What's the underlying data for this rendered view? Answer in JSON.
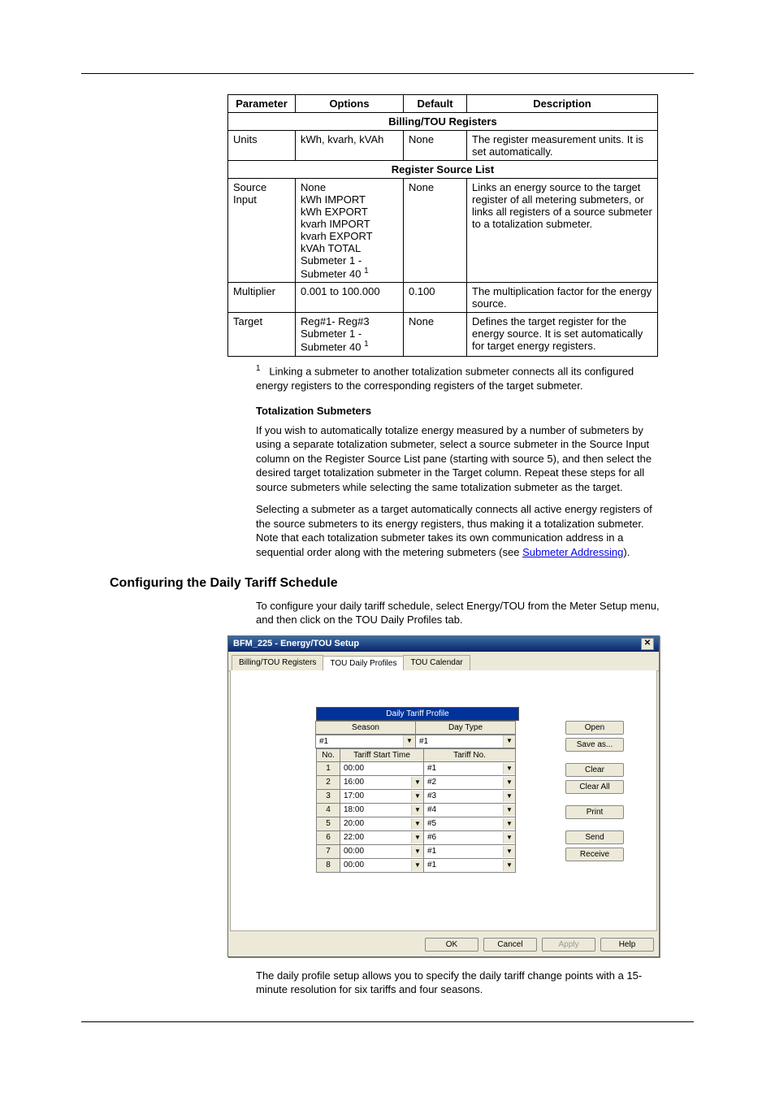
{
  "table": {
    "headers": [
      "Parameter",
      "Options",
      "Default",
      "Description"
    ],
    "section1": "Billing/TOU Registers",
    "row_units": {
      "param": "Units",
      "options": "kWh, kvarh, kVAh",
      "default": "None",
      "desc": "The register measurement units. It is set automatically."
    },
    "section2": "Register Source List",
    "row_source": {
      "param": "Source Input",
      "options_lines": [
        "None",
        "kWh IMPORT",
        "kWh EXPORT",
        "kvarh IMPORT",
        "kvarh EXPORT",
        "kVAh TOTAL",
        "Submeter 1 - Submeter 40"
      ],
      "default": "None",
      "desc": "Links an energy source to the target register of all metering submeters, or links all registers of a source submeter to a totalization submeter."
    },
    "row_mult": {
      "param": "Multiplier",
      "options": "0.001 to 100.000",
      "default": "0.100",
      "desc": "The multiplication factor for the energy source."
    },
    "row_target": {
      "param": "Target",
      "options_lines": [
        "Reg#1- Reg#3",
        "Submeter 1 - Submeter 40"
      ],
      "default": "None",
      "desc": "Defines the target register for the energy source. It is set automatically for target energy registers."
    }
  },
  "footnote_marker": "1",
  "footnote_text": "Linking a submeter to another totalization submeter connects all its configured energy registers to the corresponding registers of the target submeter.",
  "totalization_heading": "Totalization Submeters",
  "totalization_p1": "If you wish to automatically totalize energy measured by a number of submeters by using a separate totalization submeter, select a source submeter in the Source Input column on the Register Source List pane (starting with source 5), and then select the desired target totalization submeter in the Target column. Repeat these steps for all source submeters while selecting the same totalization submeter as the target.",
  "totalization_p2_a": "Selecting a submeter as a target automatically connects all active energy registers of the source submeters to its energy registers, thus making it a totalization submeter. Note that each totalization submeter takes its own communication address in a sequential order along with the metering submeters (see ",
  "totalization_link": "Submeter Addressing",
  "totalization_p2_b": ").",
  "h2": "Configuring the Daily Tariff Schedule",
  "h2_text": "To configure your daily tariff schedule, select Energy/TOU from the Meter Setup menu, and then click on the TOU Daily Profiles tab.",
  "dialog": {
    "title": "BFM_225 - Energy/TOU Setup",
    "tabs": [
      "Billing/TOU Registers",
      "TOU Daily Profiles",
      "TOU Calendar"
    ],
    "active_tab": 1,
    "profile_title": "Daily Tariff Profile",
    "header_season": "Season",
    "header_daytype": "Day Type",
    "season_value": "#1",
    "daytype_value": "#1",
    "col_no": "No.",
    "col_start": "Tariff Start Time",
    "col_tariff": "Tariff No.",
    "rows": [
      {
        "n": "1",
        "time": "00:00",
        "tariff": "#1",
        "time_dd": false
      },
      {
        "n": "2",
        "time": "16:00",
        "tariff": "#2",
        "time_dd": true
      },
      {
        "n": "3",
        "time": "17:00",
        "tariff": "#3",
        "time_dd": true
      },
      {
        "n": "4",
        "time": "18:00",
        "tariff": "#4",
        "time_dd": true
      },
      {
        "n": "5",
        "time": "20:00",
        "tariff": "#5",
        "time_dd": true
      },
      {
        "n": "6",
        "time": "22:00",
        "tariff": "#6",
        "time_dd": true
      },
      {
        "n": "7",
        "time": "00:00",
        "tariff": "#1",
        "time_dd": true
      },
      {
        "n": "8",
        "time": "00:00",
        "tariff": "#1",
        "time_dd": true
      }
    ],
    "buttons": {
      "open": "Open",
      "saveas": "Save as...",
      "clear": "Clear",
      "clearall": "Clear All",
      "print": "Print",
      "send": "Send",
      "receive": "Receive"
    },
    "footer": {
      "ok": "OK",
      "cancel": "Cancel",
      "apply": "Apply",
      "help": "Help"
    }
  },
  "closing_text": "The daily profile setup allows you to specify the daily tariff change points with a 15-minute resolution for six tariffs and four seasons."
}
